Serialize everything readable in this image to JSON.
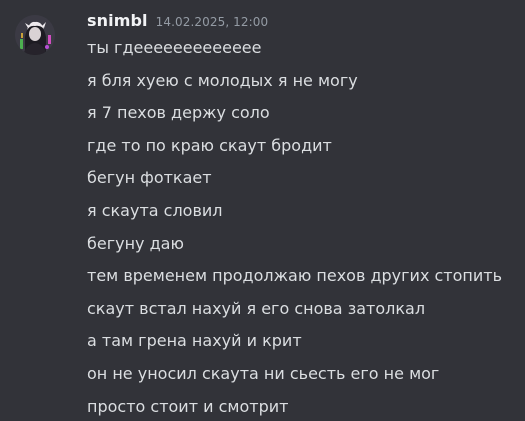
{
  "message": {
    "author": "snimbl",
    "timestamp": "14.02.2025, 12:00",
    "avatar_icon": "user-avatar-icon",
    "lines": [
      "ты гдеееееееееееее",
      "я бля хуею с молодых я не могу",
      "я 7 пехов держу соло",
      "где то по краю скаут бродит",
      "бегун фоткает",
      "я скаута словил",
      "бегуну даю",
      "тем временем продолжаю пехов других стопить",
      "скаут встал нахуй я его снова затолкал",
      "а там грена нахуй и крит",
      "он не уносил скаута ни сьесть его не мог",
      "просто стоит и смотрит"
    ]
  },
  "colors": {
    "background": "#323339",
    "username": "#f2f3f5",
    "timestamp": "#949ba4",
    "message_text": "#dbdee1"
  }
}
